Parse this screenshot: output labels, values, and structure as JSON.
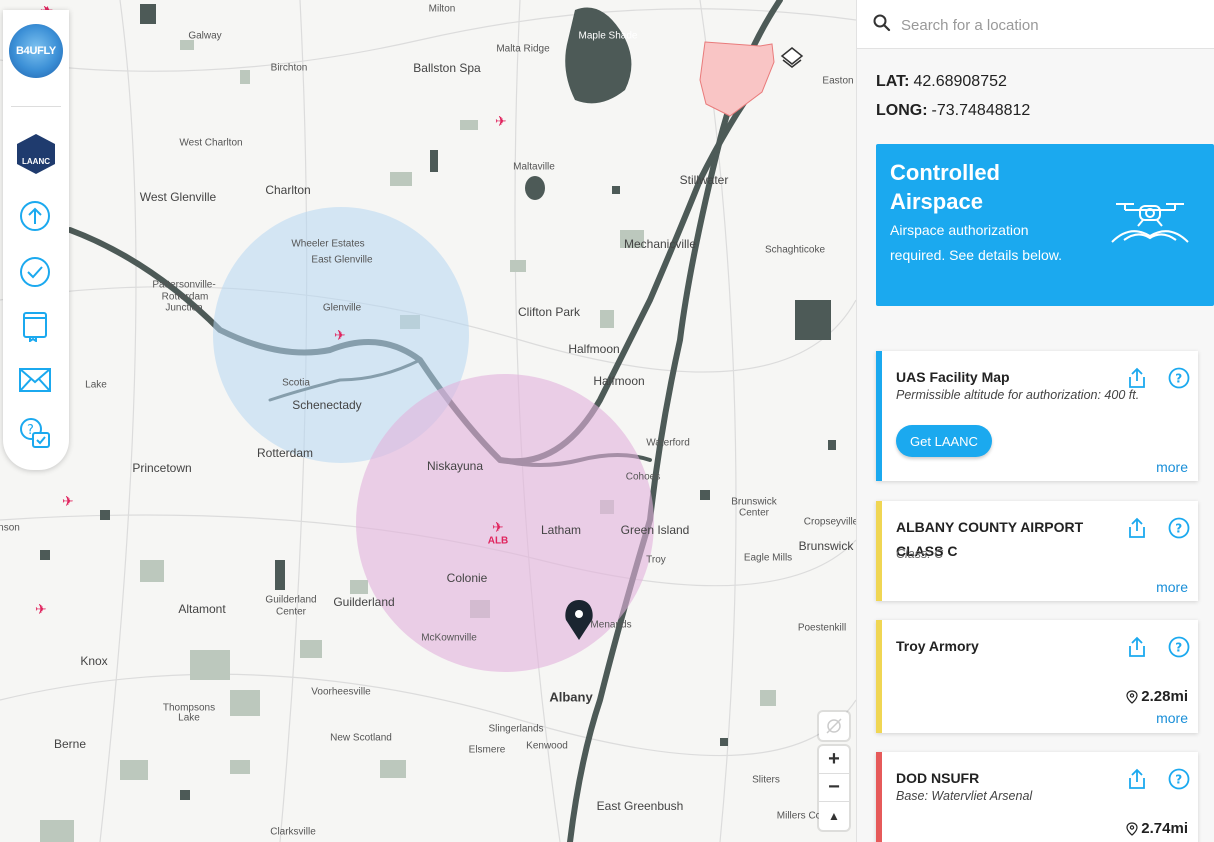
{
  "brand": {
    "logo_text": "B4UFLY",
    "laanc_badge": "LAANC"
  },
  "search": {
    "placeholder": "Search for a location",
    "value": ""
  },
  "coords": {
    "lat_label": "LAT:",
    "lat_value": "42.68908752",
    "long_label": "LONG:",
    "long_value": "-73.74848812"
  },
  "status": {
    "title": "Controlled Airspace",
    "description": "Airspace authorization required. See details below.",
    "color": "#1ba9ef"
  },
  "advisories": [
    {
      "name": "UAS Facility Map",
      "subtitle": "Permissible altitude for authorization: 400 ft.",
      "button": "Get LAANC",
      "more": "more",
      "color": "#1ba9ef"
    },
    {
      "name": "ALBANY COUNTY AIRPORT CLASS C",
      "subtitle": "Class: C",
      "more": "more",
      "color": "#f0d653"
    },
    {
      "name": "Troy Armory",
      "distance": "2.28mi",
      "more": "more",
      "color": "#f0d653"
    },
    {
      "name": "DOD NSUFR",
      "subtitle": "Base: Watervliet Arsenal",
      "distance": "2.74mi",
      "color": "#e65a5a"
    }
  ],
  "map": {
    "places": {
      "milton": "Milton",
      "galway": "Galway",
      "birchton": "Birchton",
      "ballston_spa": "Ballston Spa",
      "malta_ridge": "Malta Ridge",
      "maple_shade": "Maple Shade",
      "easton": "Easton",
      "west_charlton": "West Charlton",
      "maltaville": "Maltaville",
      "stillwater": "Stillwater",
      "west_glenville": "West Glenville",
      "charlton": "Charlton",
      "wheeler_estates": "Wheeler Estates",
      "east_glenville": "East Glenville",
      "mechanicville": "Mechanicville",
      "schaghticoke": "Schaghticoke",
      "pattersonville": "Pattersonville-",
      "rotterdam_junction": "Rotterdam",
      "junction": "Junction",
      "glenville": "Glenville",
      "clifton_park": "Clifton Park",
      "halfmoon1": "Halfmoon",
      "halfmoon2": "Halfmoon",
      "scotia": "Scotia",
      "schenectady": "Schenectady",
      "lake": "Lake",
      "waterford": "Waterford",
      "rotterdam": "Rotterdam",
      "niskayuna": "Niskayuna",
      "cohoes": "Cohoes",
      "princetown": "Princetown",
      "brunswick_center": "Brunswick",
      "center": "Center",
      "latham": "Latham",
      "green_island": "Green Island",
      "cropseyville": "Cropseyville",
      "brunswick": "Brunswick",
      "eagle_mills": "Eagle Mills",
      "troy": "Troy",
      "colonie": "Colonie",
      "guilderland_center": "Guilderland",
      "center2": "Center",
      "guilderland": "Guilderland",
      "altamont": "Altamont",
      "mckownville": "McKownville",
      "menands": "Menands",
      "poestenkill": "Poestenkill",
      "knox": "Knox",
      "voorheesville": "Voorheesville",
      "thompsons_lake": "Thompsons",
      "lake2": "Lake",
      "albany": "Albany",
      "berne": "Berne",
      "new_scotland": "New Scotland",
      "slingerlands": "Slingerlands",
      "elsmere": "Elsmere",
      "kenwood": "Kenwood",
      "sliters": "Sliters",
      "east_greenbush": "East Greenbush",
      "millers_corners": "Millers Co",
      "clarksville": "Clarksville",
      "alb": "ALB",
      "nson": "nson"
    },
    "zoom_in": "+",
    "zoom_out": "−",
    "compass": "▲"
  }
}
